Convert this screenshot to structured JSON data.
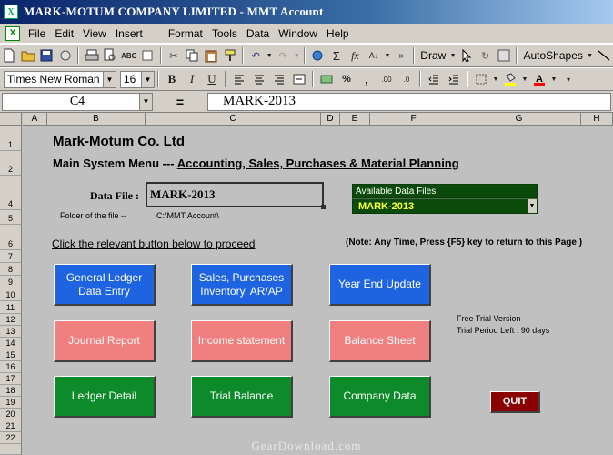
{
  "window": {
    "title": "MARK-MOTUM COMPANY LIMITED - MMT Account"
  },
  "menu": [
    "File",
    "Edit",
    "View",
    "Insert",
    "Format",
    "Tools",
    "Data",
    "Window",
    "Help"
  ],
  "toolbar": {
    "draw_label": "Draw",
    "autoshapes_label": "AutoShapes"
  },
  "format": {
    "font": "Times New Roman",
    "size": "16"
  },
  "formula_bar": {
    "cell_ref": "C4",
    "equals": "=",
    "content": "MARK-2013"
  },
  "columns": [
    "A",
    "B",
    "C",
    "D",
    "E",
    "F",
    "G",
    "H"
  ],
  "rows": [
    "1",
    "2",
    "4",
    "5",
    "6",
    "7",
    "8",
    "9",
    "10",
    "11",
    "12",
    "13",
    "14",
    "15",
    "16",
    "17",
    "18",
    "19",
    "20",
    "21",
    "22"
  ],
  "sheet": {
    "company_name": "Mark-Motum Co. Ltd",
    "menu_title_prefix": "Main System Menu --- ",
    "menu_title_main": "Accounting, Sales, Purchases & Material Planning",
    "data_file_label": "Data File :",
    "data_file_value": "MARK-2013",
    "folder_label": "Folder of the file --",
    "folder_value": "C:\\MMT Account\\",
    "available_header": "Available Data Files",
    "available_selected": "MARK-2013",
    "click_instruction": "Click the relevant button below to proceed",
    "note": "(Note:  Any Time, Press {F5} key to return to this Page )",
    "trial_line1": "Free Trial Version",
    "trial_line2": "Trial Period Left : 90 days"
  },
  "buttons": {
    "general_ledger_1": "General Ledger",
    "general_ledger_2": "Data Entry",
    "sales_1": "Sales, Purchases",
    "sales_2": "Inventory, AR/AP",
    "year_end": "Year End Update",
    "journal": "Journal Report",
    "income": "Income statement",
    "balance_sheet": "Balance Sheet",
    "ledger_detail": "Ledger Detail",
    "trial_balance": "Trial Balance",
    "company_data": "Company Data",
    "quit": "QUIT"
  },
  "watermark": "GearDownload.com",
  "colors": {
    "blue": "#1e63e0",
    "pink": "#f08080",
    "green": "#0d8a2a",
    "quit": "#8b0000",
    "sheet_bg": "#c0c0c0"
  }
}
